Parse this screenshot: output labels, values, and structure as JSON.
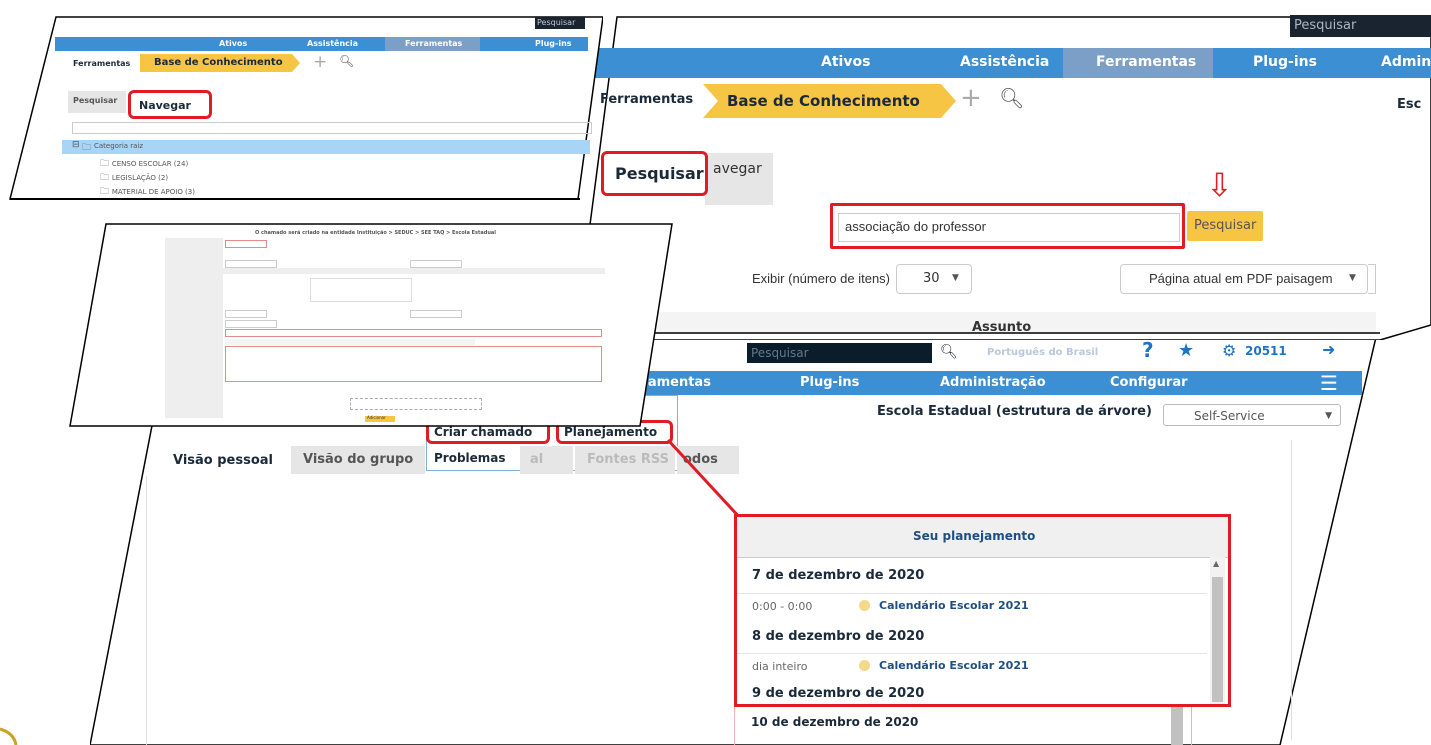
{
  "panel_a": {
    "search_placeholder": "Pesquisar",
    "nav": [
      "Ativos",
      "Assistência",
      "Ferramentas",
      "Plug-ins"
    ],
    "crumb_root": "Ferramentas",
    "crumb_current": "Base de Conhecimento",
    "tab_search": "Pesquisar",
    "tab_browse": "Navegar",
    "tree_root": "Categoria raiz",
    "tree_items": [
      "CENSO ESCOLAR (24)",
      "LEGISLAÇÃO (2)",
      "MATERIAL DE APOIO (3)"
    ]
  },
  "panel_b": {
    "search_placeholder": "Pesquisar",
    "nav": [
      "Ativos",
      "Assistência",
      "Ferramentas",
      "Plug-ins",
      "Admin"
    ],
    "crumb_root": "Ferramentas",
    "crumb_current": "Base de Conhecimento",
    "right_cut": "Esc",
    "tab_search": "Pesquisar",
    "tab_browse": "avegar",
    "query_value": "associação do professor",
    "search_button": "Pesquisar",
    "display_label": "Exibir (número de itens)",
    "display_value": "30",
    "export_value": "Página atual em PDF paisagem",
    "column_header": "Assunto"
  },
  "panel_c": {
    "title": "O chamado será criado na entidade Instituição > SEDUC > SEE TAQ > Escola Estadual",
    "submit": "Adicionar"
  },
  "panel_d": {
    "search_placeholder": "Pesquisar",
    "language": "Português do Brasil",
    "ticket_count": "20511",
    "nav": [
      "rramentas",
      "Plug-ins",
      "Administração",
      "Configurar"
    ],
    "entity": "Escola Estadual (estrutura de árvore)",
    "profile": "Self-Service",
    "menu_partial": "s",
    "menu_create": "Criar chamado",
    "menu_planning": "Planejamento",
    "menu_problems": "Problemas",
    "tabs": [
      "Visão pessoal",
      "Visão do grupo",
      "al",
      "Fontes RSS",
      "odos"
    ],
    "planning": {
      "header": "Seu planejamento",
      "days": [
        {
          "date": "7 de dezembro de 2020",
          "time": "0:00 - 0:00",
          "event": "Calendário Escolar 2021"
        },
        {
          "date": "8 de dezembro de 2020",
          "time": "dia inteiro",
          "event": "Calendário Escolar 2021"
        },
        {
          "date": "9 de dezembro de 2020"
        },
        {
          "date": "10 de dezembro de 2020"
        }
      ]
    }
  },
  "colors": {
    "nav_blue": "#3b8fd2",
    "nav_active": "#7c9fc7",
    "crumb_gold": "#f6c544",
    "highlight_red": "#e01b24",
    "tree_blue": "#a8d4f5",
    "event_dot": "#f4d98a"
  }
}
